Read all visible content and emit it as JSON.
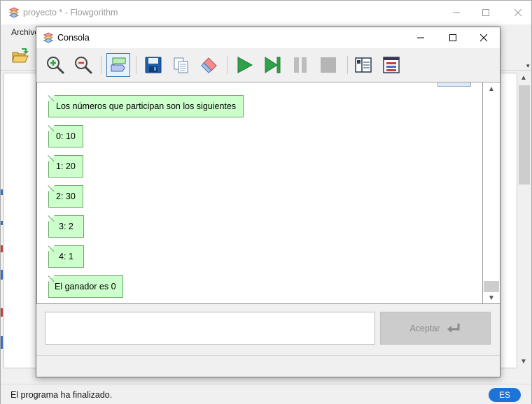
{
  "main_window": {
    "title": "proyecto * - Flowgorithm",
    "menu": {
      "file": "Archivo"
    },
    "status": "El programa ha finalizado.",
    "language_badge": "ES"
  },
  "console": {
    "title": "Consola",
    "toolbar": [
      {
        "name": "zoom-in-icon"
      },
      {
        "name": "zoom-out-icon"
      },
      {
        "name": "chat-view-icon",
        "active": true
      },
      {
        "name": "save-icon"
      },
      {
        "name": "copy-icon"
      },
      {
        "name": "eraser-icon"
      },
      {
        "name": "run-icon"
      },
      {
        "name": "step-icon"
      },
      {
        "name": "pause-icon"
      },
      {
        "name": "stop-icon"
      },
      {
        "name": "layout-split-icon"
      },
      {
        "name": "layout-variables-icon"
      }
    ],
    "messages": [
      "Los números que participan son los siguientes",
      "0: 10",
      "1: 20",
      "2: 30",
      "3: 2",
      "4: 1",
      "El ganador es 0"
    ],
    "input": {
      "value": "",
      "placeholder": ""
    },
    "accept_label": "Aceptar"
  },
  "colors": {
    "output_bubble_fill": "#ccffcc",
    "output_bubble_border": "#66aa66",
    "accent": "#1e73d8",
    "run_green": "#2ea24a"
  }
}
